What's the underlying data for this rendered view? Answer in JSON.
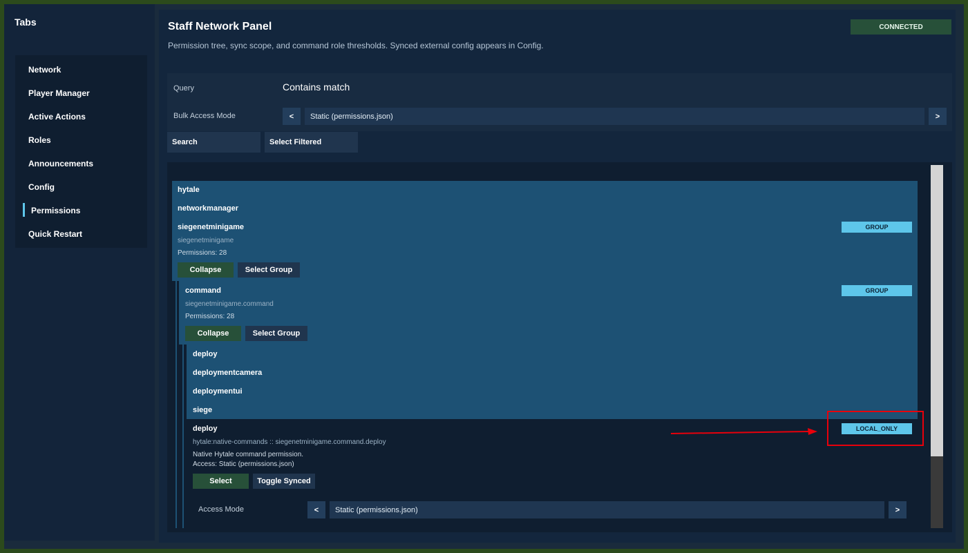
{
  "sidebar": {
    "title": "Tabs",
    "items": [
      {
        "label": "Network"
      },
      {
        "label": "Player Manager"
      },
      {
        "label": "Active Actions"
      },
      {
        "label": "Roles"
      },
      {
        "label": "Announcements"
      },
      {
        "label": "Config"
      },
      {
        "label": "Permissions",
        "active": true
      },
      {
        "label": "Quick Restart"
      }
    ]
  },
  "header": {
    "title": "Staff Network Panel",
    "subtitle": "Permission tree, sync scope, and command role thresholds. Synced external config appears in Config.",
    "status": "CONNECTED"
  },
  "query": {
    "label": "Query",
    "value": "Contains match",
    "bulk_label": "Bulk Access Mode",
    "bulk_value": "Static (permissions.json)",
    "prev": "<",
    "next": ">",
    "search_button": "Search",
    "select_filtered_button": "Select Filtered"
  },
  "tree": {
    "root_items": [
      "hytale",
      "networkmanager"
    ],
    "group1": {
      "name": "siegenetminigame",
      "path": "siegenetminigame",
      "permissions": "Permissions: 28",
      "tag": "GROUP",
      "collapse": "Collapse",
      "select_group": "Select Group"
    },
    "group2": {
      "name": "command",
      "path": "siegenetminigame.command",
      "permissions": "Permissions: 28",
      "tag": "GROUP",
      "collapse": "Collapse",
      "select_group": "Select Group"
    },
    "children": [
      "deploy",
      "deploymentcamera",
      "deploymentui",
      "siege"
    ],
    "detail": {
      "name": "deploy",
      "path": "hytale:native-commands :: siegenetminigame.command.deploy",
      "description": "Native Hytale command permission.",
      "access": "Access: Static (permissions.json)",
      "tag": "LOCAL_ONLY",
      "select": "Select",
      "toggle_synced": "Toggle Synced",
      "access_mode_label": "Access Mode",
      "access_mode_value": "Static (permissions.json)",
      "prev": "<",
      "next": ">"
    }
  },
  "colors": {
    "accent": "#5ec6ea",
    "status_green": "#275039",
    "highlight": "#1d5174",
    "annotation": "#e8000b"
  }
}
